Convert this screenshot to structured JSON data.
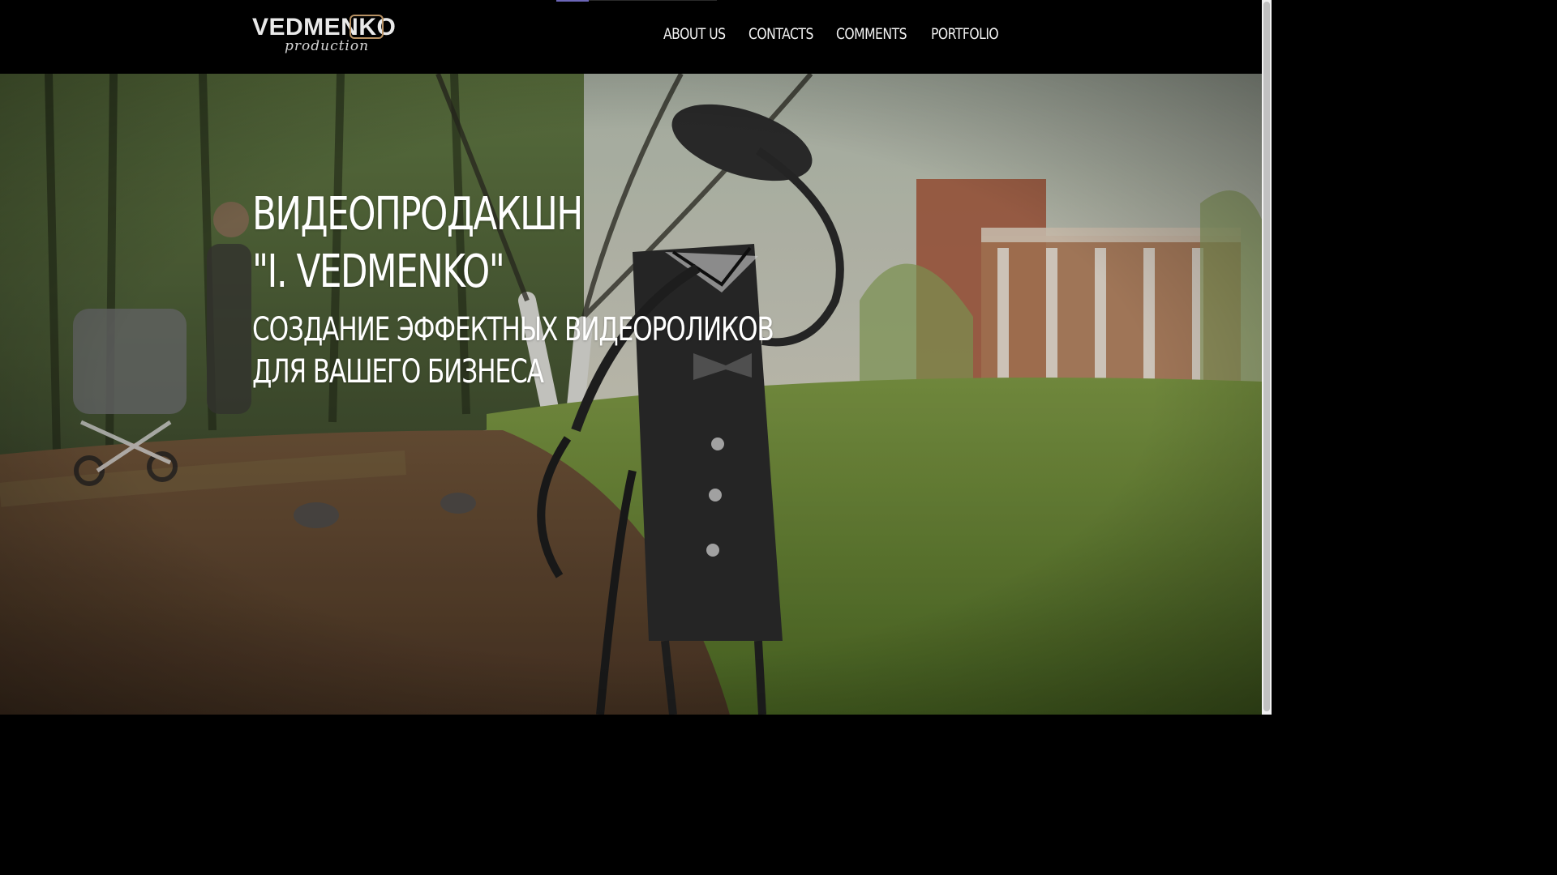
{
  "brand": {
    "logo_word": "VEDMENKO",
    "logo_sub": "production",
    "accent": "#b89264"
  },
  "nav": {
    "items": [
      {
        "label": "ABOUT US"
      },
      {
        "label": "CONTACTS"
      },
      {
        "label": "COMMENTS"
      },
      {
        "label": "PORTFOLIO"
      }
    ]
  },
  "hero": {
    "title_line1": "ВИДЕОПРОДАКШН",
    "title_line2": "\"I. VEDMENKO\"",
    "subtitle_line1": "СОЗДАНИЕ ЭФФЕКТНЫХ ВИДЕОРОЛИКОВ",
    "subtitle_line2": "ДЛЯ ВАШЕГО БИЗНЕСА"
  },
  "colors": {
    "header_bg": "#000000",
    "text": "#ffffff",
    "tab_indicator": "#6c66b8"
  }
}
